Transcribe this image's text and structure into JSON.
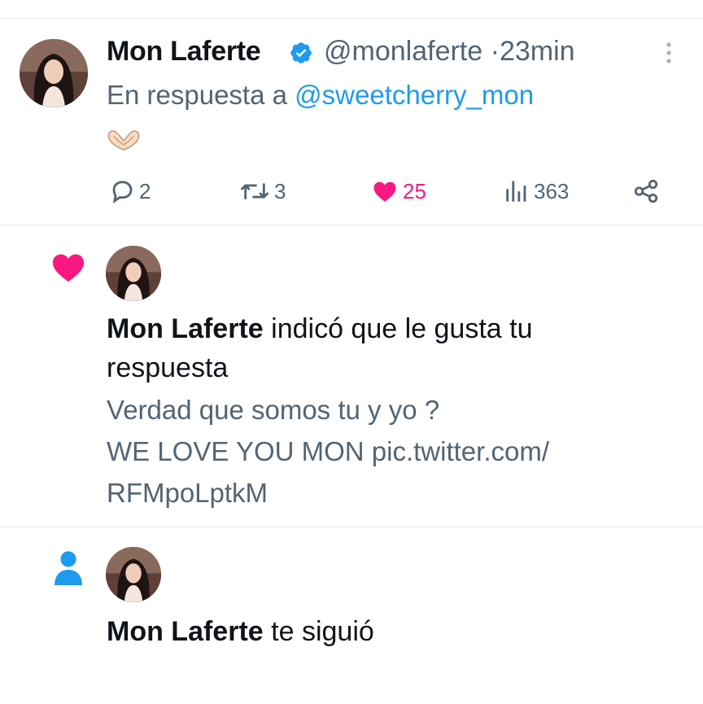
{
  "tweet": {
    "author_name": "Mon Laferte",
    "handle": "@monlaferte",
    "separator": "·",
    "time": "23min",
    "reply_prefix": "En respuesta a",
    "reply_mention": "@sweetcherry_mon",
    "body_emoji": "heart-hands",
    "actions": {
      "replies": "2",
      "retweets": "3",
      "likes": "25",
      "views": "363"
    }
  },
  "notifications": [
    {
      "type": "like",
      "actor": "Mon Laferte",
      "text": "indicó que le gusta tu respuesta",
      "quote_line1": "Verdad que somos tu y yo ?",
      "quote_line2": "WE LOVE YOU MON pic.twitter.com/",
      "quote_line3": "RFMpoLptkM"
    },
    {
      "type": "follow",
      "actor": "Mon Laferte",
      "text": "te siguió"
    }
  ],
  "colors": {
    "accent": "#1d9bf0",
    "like": "#f91880",
    "secondary_text": "#536471",
    "primary_text": "#0f1419"
  }
}
